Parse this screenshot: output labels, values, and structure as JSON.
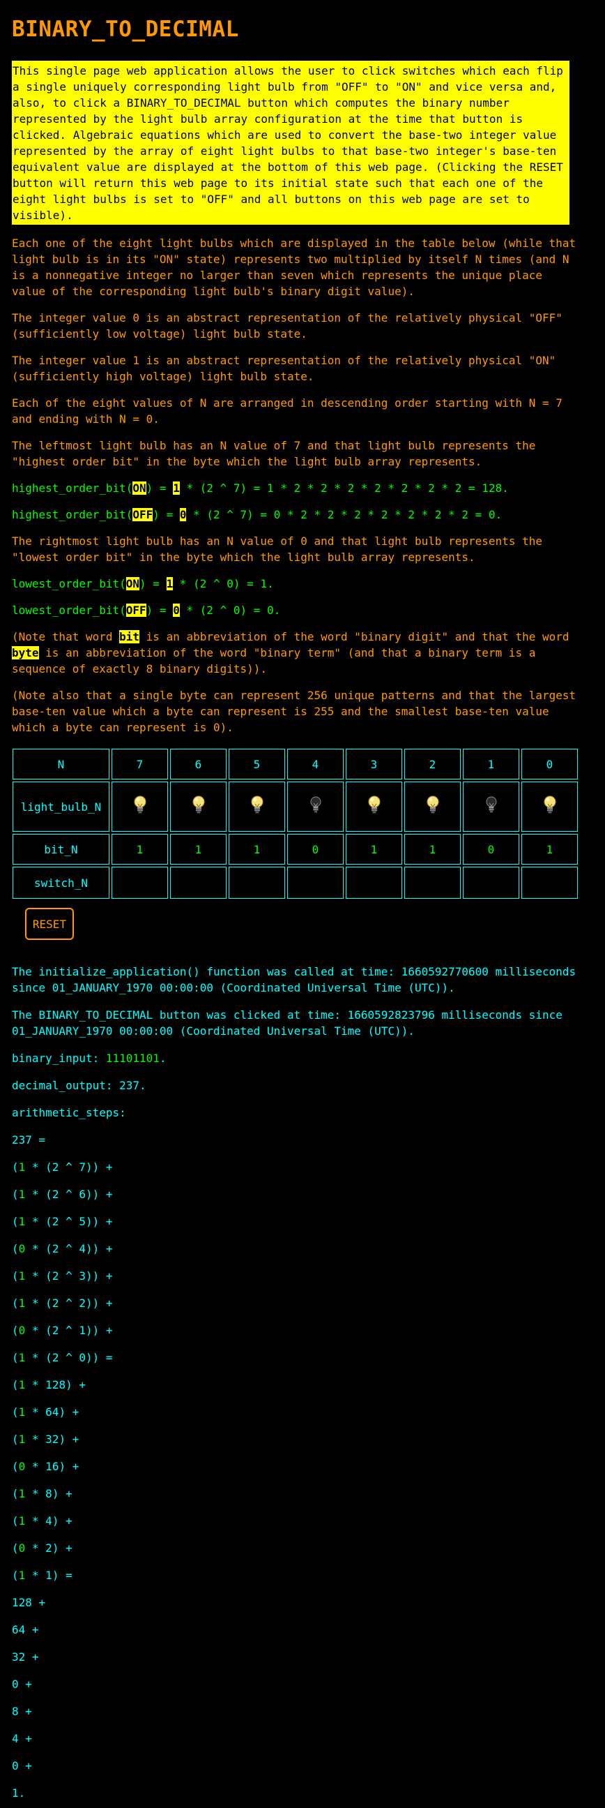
{
  "title": "BINARY_TO_DECIMAL",
  "intro": "This single page web application allows the user to click switches which each flip a single uniquely corresponding light bulb from \"OFF\" to \"ON\" and vice versa and, also, to click a BINARY_TO_DECIMAL button which computes the binary number represented by the light bulb array configuration at the time that button is clicked. Algebraic equations which are used to convert the base-two integer value represented by the array of eight light bulbs to that base-two integer's base-ten equivalent value are displayed at the bottom of this web page. (Clicking the RESET button will return this web page to its initial state such that each one of the eight light bulbs is set to \"OFF\" and all buttons on this web page are set to visible).",
  "para1": "Each one of the eight light bulbs which are displayed in the table below (while that light bulb is in its \"ON\" state) represents two multiplied by itself N times (and N is a nonnegative integer no larger than seven which represents the unique place value of the corresponding light bulb's binary digit value).",
  "para2": "The integer value 0 is an abstract representation of the relatively physical \"OFF\" (sufficiently low voltage) light bulb state.",
  "para3": "The integer value 1 is an abstract representation of the relatively physical \"ON\" (sufficiently high voltage) light bulb state.",
  "para4": "Each of the eight values of N are arranged in descending order starting with N = 7 and ending with N = 0.",
  "para5": "The leftmost light bulb has an N value of 7 and that light bulb represents the \"highest order bit\" in the byte which the light bulb array represents.",
  "hob_on": {
    "pre": "highest_order_bit(",
    "state": "ON",
    "mid": ") = ",
    "bit": "1",
    "post": " * (2 ^ 7) = 1 * 2 * 2 * 2 * 2 * 2 * 2 * 2 = 128."
  },
  "hob_off": {
    "pre": "highest_order_bit(",
    "state": "OFF",
    "mid": ") = ",
    "bit": "0",
    "post": " * (2 ^ 7) = 0 * 2 * 2 * 2 * 2 * 2 * 2 * 2 = 0."
  },
  "para6": "The rightmost light bulb has an N value of 0 and that light bulb represents the \"lowest order bit\" in the byte which the light bulb array represents.",
  "lob_on": {
    "pre": "lowest_order_bit(",
    "state": "ON",
    "mid": ") = ",
    "bit": "1",
    "post": " * (2 ^ 0) = 1."
  },
  "lob_off": {
    "pre": "lowest_order_bit(",
    "state": "OFF",
    "mid": ") = ",
    "bit": "0",
    "post": " * (2 ^ 0) = 0."
  },
  "note1": {
    "a": "(Note that word ",
    "bit": "bit",
    "b": " is an abbreviation of the word \"binary digit\" and that the word ",
    "byte": "byte",
    "c": " is an abbreviation of the word \"binary term\" (and that a binary term is a sequence of exactly 8 binary digits))."
  },
  "note2": "(Note also that a single byte can represent 256 unique patterns and that the largest base-ten value which a byte can represent is 255 and the smallest base-ten value which a byte can represent is 0).",
  "table": {
    "row_labels": {
      "n": "N",
      "bulb": "light_bulb_N",
      "bit": "bit_N",
      "switch": "switch_N"
    },
    "n_values": [
      "7",
      "6",
      "5",
      "4",
      "3",
      "2",
      "1",
      "0"
    ],
    "bulb_states": [
      "on",
      "on",
      "on",
      "off",
      "on",
      "on",
      "off",
      "on"
    ],
    "bits": [
      "1",
      "1",
      "1",
      "0",
      "1",
      "1",
      "0",
      "1"
    ]
  },
  "reset_label": "RESET",
  "init_msg": "The initialize_application() function was called at time: 1660592770600 milliseconds since 01_JANUARY_1970 00:00:00 (Coordinated Universal Time (UTC)).",
  "click_msg": "The BINARY_TO_DECIMAL button was clicked at time: 1660592823796 milliseconds since 01_JANUARY_1970 00:00:00 (Coordinated Universal Time (UTC)).",
  "binary_input_label": "binary_input: ",
  "binary_input_value": "11101101",
  "binary_input_end": ".",
  "decimal_output": "decimal_output: 237.",
  "arithmetic_label": "arithmetic_steps:",
  "steps_start": "237 =",
  "steps_a": [
    {
      "bit": "1",
      "rest": " * (2 ^ 7)) +"
    },
    {
      "bit": "1",
      "rest": " * (2 ^ 6)) +"
    },
    {
      "bit": "1",
      "rest": " * (2 ^ 5)) +"
    },
    {
      "bit": "0",
      "rest": " * (2 ^ 4)) +"
    },
    {
      "bit": "1",
      "rest": " * (2 ^ 3)) +"
    },
    {
      "bit": "1",
      "rest": " * (2 ^ 2)) +"
    },
    {
      "bit": "0",
      "rest": " * (2 ^ 1)) +"
    },
    {
      "bit": "1",
      "rest": " * (2 ^ 0)) ="
    }
  ],
  "steps_b": [
    {
      "bit": "1",
      "rest": " * 128) +"
    },
    {
      "bit": "1",
      "rest": " * 64) +"
    },
    {
      "bit": "1",
      "rest": " * 32) +"
    },
    {
      "bit": "0",
      "rest": " * 16) +"
    },
    {
      "bit": "1",
      "rest": " * 8) +"
    },
    {
      "bit": "1",
      "rest": " * 4) +"
    },
    {
      "bit": "0",
      "rest": " * 2) +"
    },
    {
      "bit": "1",
      "rest": " * 1) ="
    }
  ],
  "steps_c": [
    "128 +",
    "64 +",
    "32 +",
    "0 +",
    "8 +",
    "4 +",
    "0 +",
    "1."
  ],
  "colors": {
    "orange": "#ff9900",
    "yellow": "#ffff00",
    "green": "#00ff00",
    "cyan": "#00ffff",
    "background": "#000000"
  },
  "icons": {
    "bulb_on": "lit-light-bulb-icon",
    "bulb_off": "unlit-light-bulb-icon"
  }
}
